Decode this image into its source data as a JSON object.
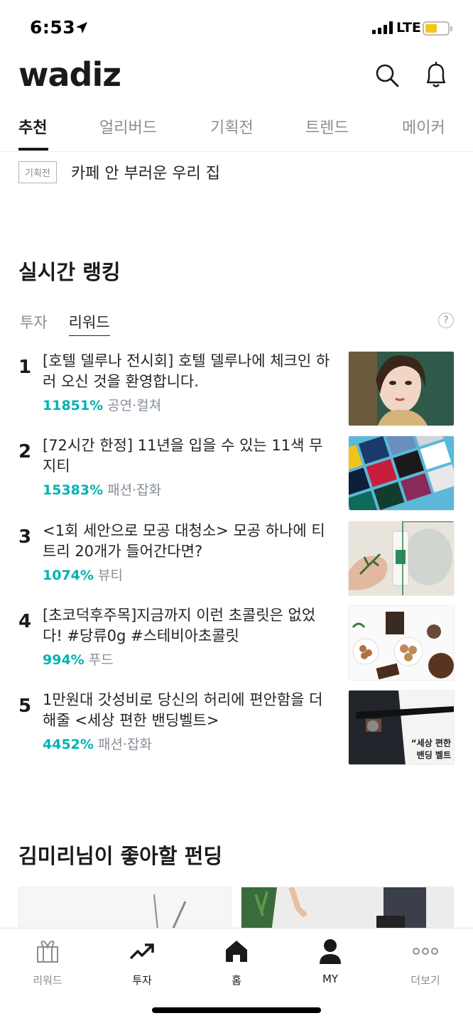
{
  "status_bar": {
    "time": "6:53",
    "network": "LTE"
  },
  "header": {
    "logo": "wadiz",
    "icons": [
      "search-icon",
      "bell-icon"
    ]
  },
  "tabs": [
    {
      "label": "추천",
      "active": true
    },
    {
      "label": "얼리버드"
    },
    {
      "label": "기획전"
    },
    {
      "label": "트렌드"
    },
    {
      "label": "메이커"
    }
  ],
  "exhibition": {
    "badge": "기획전",
    "title": "카페 안 부러운 우리 집"
  },
  "ranking": {
    "title": "실시간 랭킹",
    "tabs": [
      {
        "label": "투자"
      },
      {
        "label": "리워드",
        "active": true
      }
    ],
    "help": "?",
    "items": [
      {
        "rank": "1",
        "title": "[호텔 델루나 전시회] 호텔 델루나에 체크인 하러 오신 것을 환영합니다.",
        "percent": "11851%",
        "category": "공연·컬쳐"
      },
      {
        "rank": "2",
        "title": "[72시간 한정] 11년을 입을 수 있는 11색 무지티",
        "percent": "15383%",
        "category": "패션·잡화"
      },
      {
        "rank": "3",
        "title": " <1회 세안으로 모공 대청소> 모공 하나에 티트리 20개가 들어간다면?",
        "percent": "1074%",
        "category": "뷰티"
      },
      {
        "rank": "4",
        "title": "[초코덕후주목]지금까지 이런 초콜릿은 없었다! #당류0g #스테비아초콜릿",
        "percent": "994%",
        "category": "푸드"
      },
      {
        "rank": "5",
        "title": "1만원대 갓성비로 당신의 허리에 편안함을 더해줄 <세상 편한 밴딩벨트>",
        "percent": "4452%",
        "category": "패션·잡화",
        "thumb_caption_1": "“세상 편한",
        "thumb_caption_2": "밴딩 벨트"
      }
    ]
  },
  "recommend": {
    "title": "김미리님이 좋아할 펀딩"
  },
  "bottom_nav": [
    {
      "label": "리워드",
      "icon": "gift-icon"
    },
    {
      "label": "투자",
      "icon": "trend-up-icon"
    },
    {
      "label": "홈",
      "icon": "home-icon"
    },
    {
      "label": "MY",
      "icon": "person-icon"
    },
    {
      "label": "더보기",
      "icon": "more-icon"
    }
  ],
  "colors": {
    "accent": "#00b2b2",
    "text": "#212529",
    "muted": "#868e96"
  }
}
